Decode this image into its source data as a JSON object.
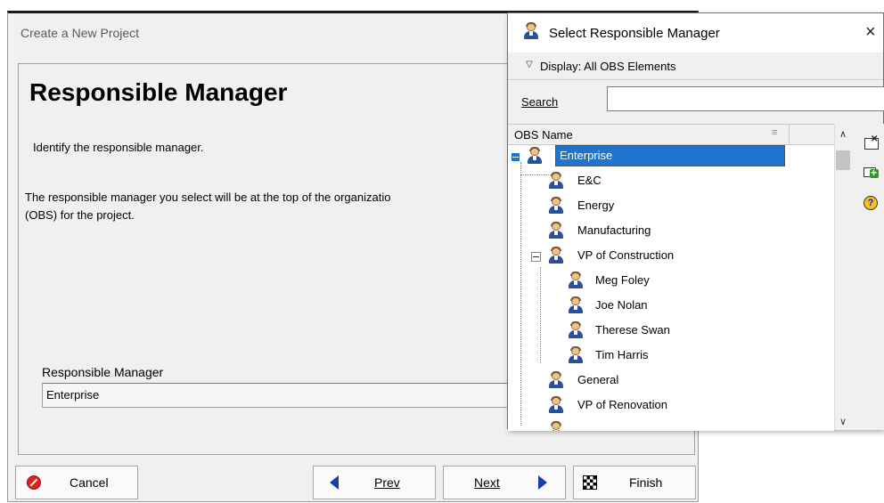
{
  "wizard": {
    "window_title": "Create a New Project",
    "heading": "Responsible Manager",
    "instruction": "Identify the responsible manager.",
    "description_line1": "The responsible manager you select will be at the top of the organizatio",
    "description_line2": "(OBS) for the project.",
    "field_label": "Responsible Manager",
    "field_value": "Enterprise",
    "buttons": {
      "cancel": "Cancel",
      "prev": "Prev",
      "next": "Next",
      "finish": "Finish"
    }
  },
  "dialog": {
    "title": "Select Responsible Manager",
    "close_glyph": "×",
    "display_label": "Display: All OBS Elements",
    "display_chevron": "▽",
    "search_label": "Search",
    "search_value": "",
    "column_header": "OBS Name",
    "tree": [
      {
        "label": "Enterprise",
        "level": 0,
        "expanded": true,
        "selected": true
      },
      {
        "label": "E&C",
        "level": 1
      },
      {
        "label": "Energy",
        "level": 1
      },
      {
        "label": "Manufacturing",
        "level": 1
      },
      {
        "label": "VP of Construction",
        "level": 1,
        "expanded": true
      },
      {
        "label": "Meg Foley",
        "level": 2
      },
      {
        "label": "Joe Nolan",
        "level": 2
      },
      {
        "label": "Therese Swan",
        "level": 2
      },
      {
        "label": "Tim Harris",
        "level": 2
      },
      {
        "label": "General",
        "level": 1
      },
      {
        "label": "VP of Renovation",
        "level": 1
      }
    ],
    "side_icons": [
      "delete-icon",
      "add-icon",
      "help-icon"
    ]
  },
  "colors": {
    "selection": "#1f74d0",
    "nav_arrow": "#1a3faa",
    "cancel_red": "#e0201b"
  }
}
